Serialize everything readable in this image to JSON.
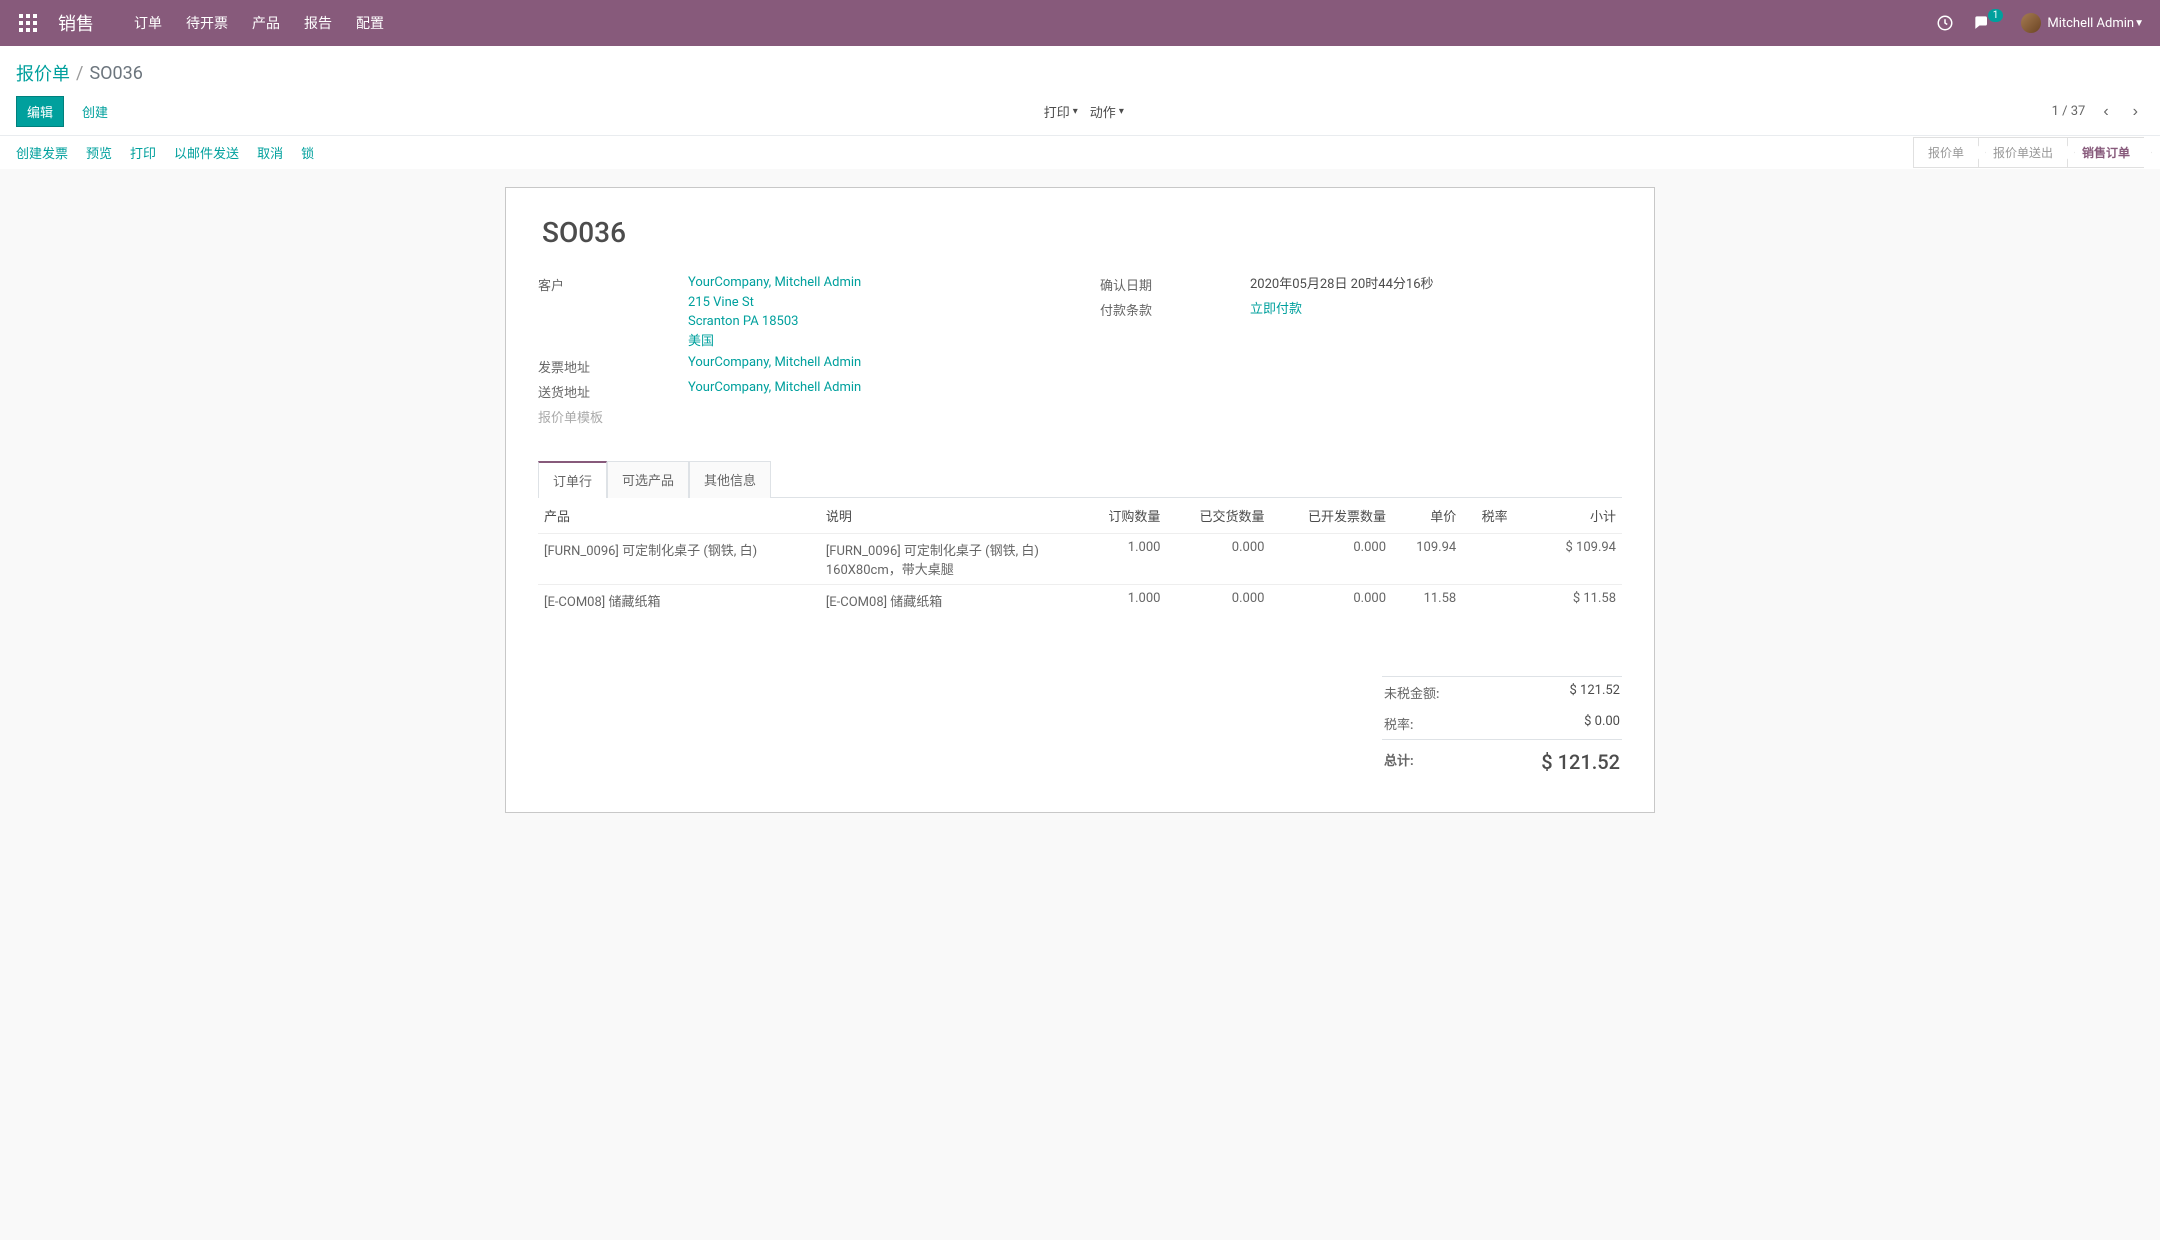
{
  "topbar": {
    "app_name": "销售",
    "nav": [
      "订单",
      "待开票",
      "产品",
      "报告",
      "配置"
    ],
    "msg_count": "1",
    "user_name": "Mitchell Admin"
  },
  "breadcrumb": {
    "root": "报价单",
    "current": "SO036"
  },
  "buttons": {
    "edit": "编辑",
    "create": "创建",
    "print": "打印",
    "action": "动作"
  },
  "pager": {
    "pos": "1",
    "total": "37"
  },
  "actions": {
    "create_invoice": "创建发票",
    "preview": "预览",
    "print": "打印",
    "send_mail": "以邮件发送",
    "cancel": "取消",
    "lock": "锁"
  },
  "status_steps": [
    {
      "label": "报价单",
      "active": false
    },
    {
      "label": "报价单送出",
      "active": false
    },
    {
      "label": "销售订单",
      "active": true
    }
  ],
  "order": {
    "name": "SO036",
    "labels": {
      "customer": "客户",
      "invoice_addr": "发票地址",
      "shipping_addr": "送货地址",
      "template": "报价单模板",
      "confirm_date": "确认日期",
      "payment_term": "付款条款"
    },
    "customer": {
      "name": "YourCompany, Mitchell Admin",
      "street": "215 Vine St",
      "city": "Scranton PA 18503",
      "country": "美国"
    },
    "invoice_addr": "YourCompany, Mitchell Admin",
    "shipping_addr": "YourCompany, Mitchell Admin",
    "confirm_date": "2020年05月28日 20时44分16秒",
    "payment_term": "立即付款"
  },
  "tabs": [
    "订单行",
    "可选产品",
    "其他信息"
  ],
  "table": {
    "headers": {
      "product": "产品",
      "desc": "说明",
      "qty": "订购数量",
      "delivered": "已交货数量",
      "invoiced": "已开发票数量",
      "price": "单价",
      "tax": "税率",
      "subtotal": "小计"
    },
    "rows": [
      {
        "product": "[FURN_0096] 可定制化桌子 (钢铁, 白)",
        "desc": "[FURN_0096] 可定制化桌子 (钢铁, 白)\n160X80cm，带大桌腿",
        "qty": "1.000",
        "delivered": "0.000",
        "invoiced": "0.000",
        "price": "109.94",
        "tax": "",
        "subtotal": "$ 109.94"
      },
      {
        "product": "[E-COM08] 储藏纸箱",
        "desc": "[E-COM08] 储藏纸箱",
        "qty": "1.000",
        "delivered": "0.000",
        "invoiced": "0.000",
        "price": "11.58",
        "tax": "",
        "subtotal": "$ 11.58"
      }
    ]
  },
  "totals": {
    "untaxed_label": "未税金额:",
    "untaxed": "$ 121.52",
    "tax_label": "税率:",
    "tax": "$ 0.00",
    "total_label": "总计:",
    "total": "$ 121.52"
  }
}
